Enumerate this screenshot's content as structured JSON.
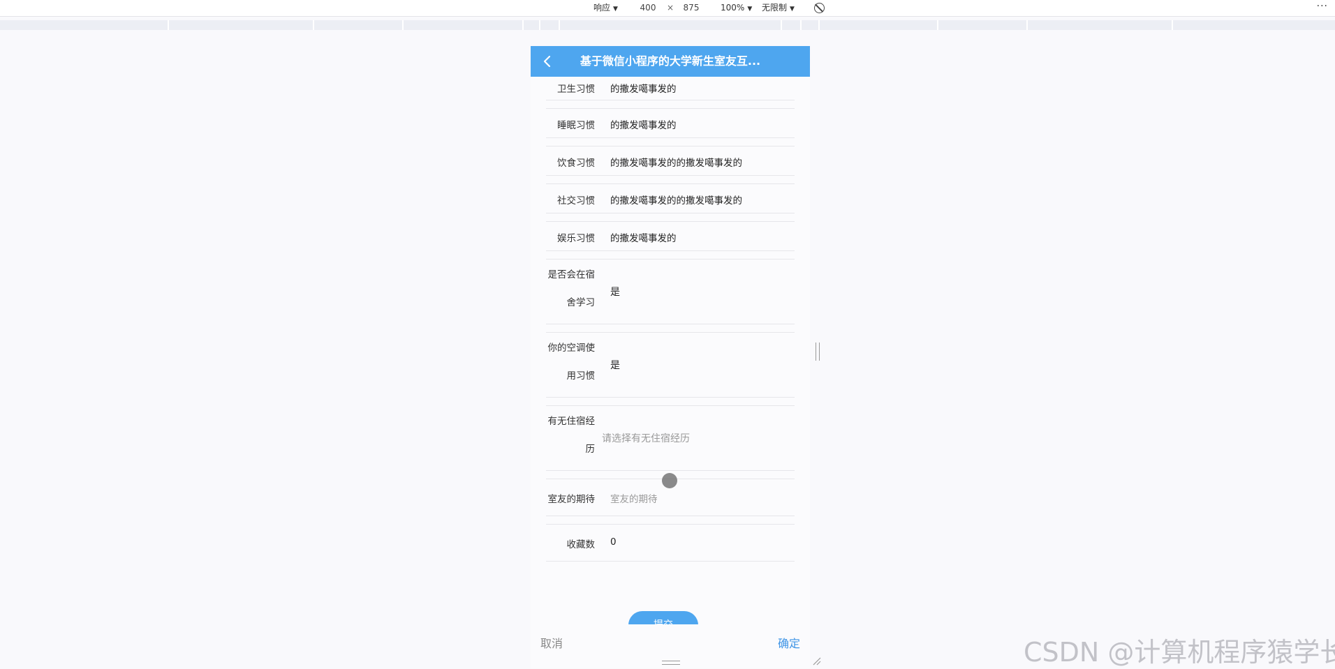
{
  "devtools": {
    "mode": "响应",
    "width": "400",
    "times": "×",
    "height": "875",
    "zoom": "100%",
    "throttle": "无限制",
    "caret": "▼",
    "more": "···"
  },
  "app": {
    "title": "基于微信小程序的大学新生室友互..."
  },
  "form": {
    "rows": [
      {
        "label": "卫生习惯",
        "value": "的撒发噶事发的"
      },
      {
        "label": "睡眠习惯",
        "value": "的撒发噶事发的"
      },
      {
        "label": "饮食习惯",
        "value": "的撒发噶事发的的撒发噶事发的"
      },
      {
        "label": "社交习惯",
        "value": "的撒发噶事发的的撒发噶事发的"
      },
      {
        "label": "娱乐习惯",
        "value": "的撒发噶事发的"
      }
    ],
    "study": {
      "label_line1": "是否会在宿",
      "label_line2": "舍学习",
      "value": "是"
    },
    "aircon": {
      "label_line1": "你的空调使",
      "label_line2": "用习惯",
      "value": "是"
    },
    "dorm_exp": {
      "label_line1": "有无住宿经",
      "label_line2": "历",
      "placeholder": "请选择有无住宿经历"
    },
    "expect": {
      "label": "室友的期待",
      "placeholder": "室友的期待"
    },
    "favorites": {
      "label": "收藏数",
      "value": "0"
    },
    "submit_label": "提交"
  },
  "picker": {
    "cancel_label": "取消",
    "confirm_label": "确定"
  },
  "watermark": "CSDN @计算机程序猿学长",
  "colors": {
    "accent": "#4ea6ef",
    "confirm": "#3e94e6"
  }
}
